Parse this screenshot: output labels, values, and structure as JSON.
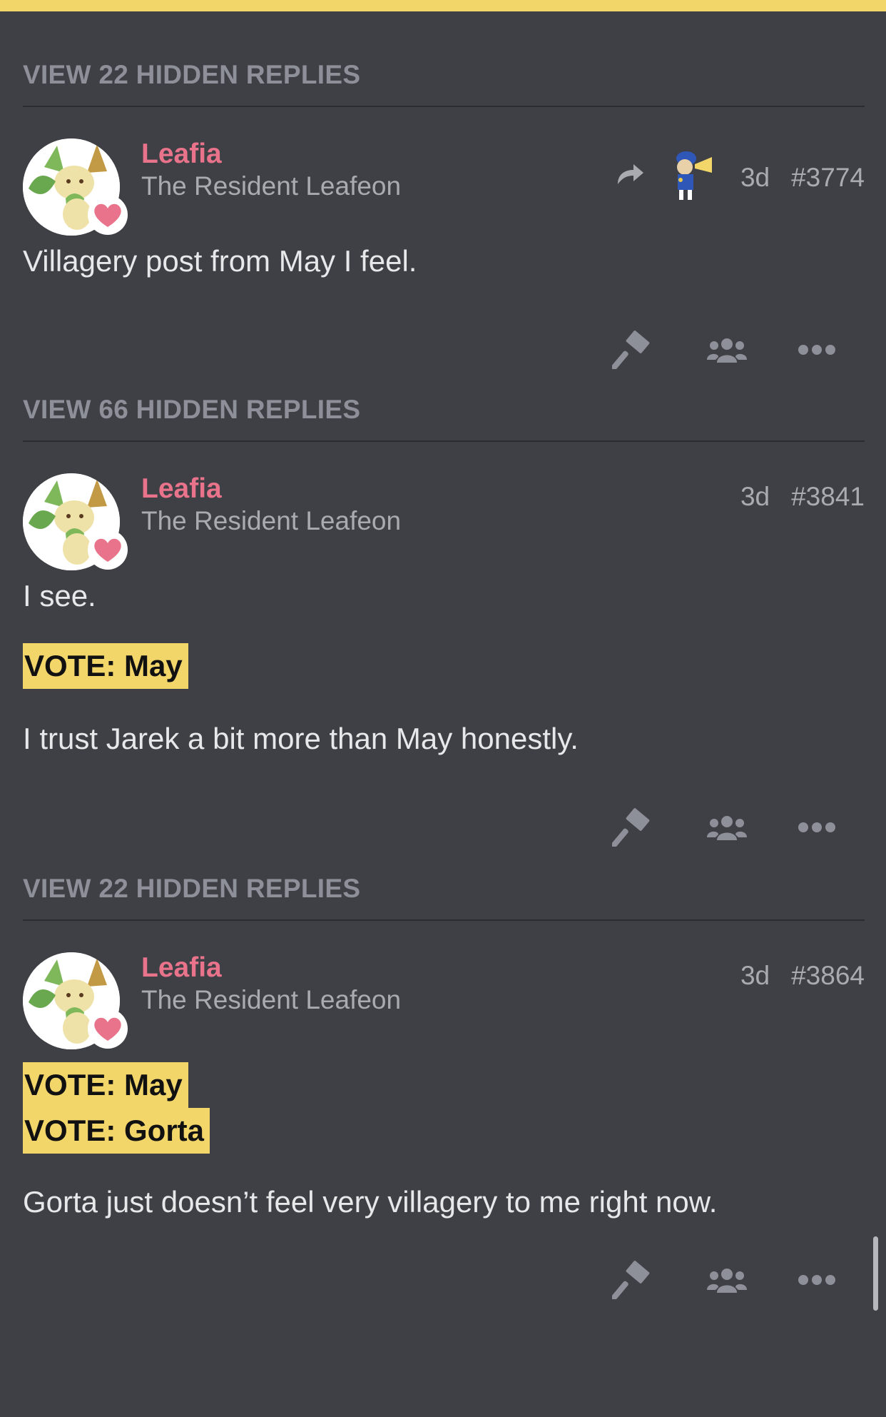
{
  "accent_colors": {
    "top_bar": "#f2d66a",
    "username": "#e8738b",
    "vote_highlight": "#f2d66a",
    "background": "#3e4045"
  },
  "posts": [
    {
      "hidden_replies": "VIEW 22 HIDDEN REPLIES",
      "username": "Leafia",
      "user_title": "The Resident Leafeon",
      "age": "3d",
      "number": "#3774",
      "has_reply_to": true,
      "paragraphs": [
        "Villagery post from May I feel."
      ]
    },
    {
      "hidden_replies": "VIEW 66 HIDDEN REPLIES",
      "username": "Leafia",
      "user_title": "The Resident Leafeon",
      "age": "3d",
      "number": "#3841",
      "has_reply_to": false,
      "paragraphs": [
        "I see."
      ],
      "votes": [
        "VOTE: May"
      ],
      "after_votes": [
        "I trust Jarek a bit more than May honestly."
      ]
    },
    {
      "hidden_replies": "VIEW 22 HIDDEN REPLIES",
      "username": "Leafia",
      "user_title": "The Resident Leafeon",
      "age": "3d",
      "number": "#3864",
      "has_reply_to": false,
      "votes": [
        "VOTE: May",
        "VOTE: Gorta"
      ],
      "after_votes": [
        "Gorta just doesn’t feel very villagery to me right now."
      ]
    }
  ],
  "icons": {
    "reply_to": "share-arrow-icon",
    "hammer": "gavel-icon",
    "group": "users-icon",
    "more": "ellipsis-icon",
    "avatar_badge": "heart-icon"
  }
}
